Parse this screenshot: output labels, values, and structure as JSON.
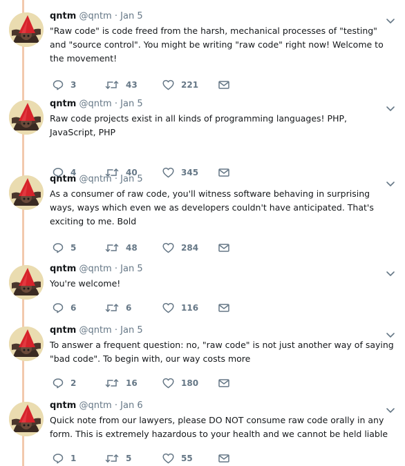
{
  "tweets": [
    {
      "name": "qntm",
      "handle": "@qntm",
      "separator": "·",
      "date": "Jan 5",
      "text": "\"Raw code\" is code freed from the harsh, mechanical processes of \"testing\" and \"source control\". You might be writing \"raw code\" right now! Welcome to the movement!",
      "replies": "3",
      "retweets": "43",
      "likes": "221"
    },
    {
      "name": "qntm",
      "handle": "@qntm",
      "separator": "·",
      "date": "Jan 5",
      "text": "Raw code projects exist in all kinds of programming languages! PHP, JavaScript, PHP",
      "replies": "4",
      "retweets": "40",
      "likes": "345"
    },
    {
      "name": "qntm",
      "handle": "@qntm",
      "separator": "·",
      "date": "Jan 5",
      "text": "As a consumer of raw code, you'll witness software behaving in surprising ways, ways which even we as developers couldn't have anticipated. That's exciting to me. Bold",
      "replies": "5",
      "retweets": "48",
      "likes": "284"
    },
    {
      "name": "qntm",
      "handle": "@qntm",
      "separator": "·",
      "date": "Jan 5",
      "text": "You're welcome!",
      "replies": "6",
      "retweets": "6",
      "likes": "116"
    },
    {
      "name": "qntm",
      "handle": "@qntm",
      "separator": "·",
      "date": "Jan 5",
      "text": "To answer a frequent question: no, \"raw code\" is not just another way of saying \"bad code\". To begin with, our way costs more",
      "replies": "2",
      "retweets": "16",
      "likes": "180"
    },
    {
      "name": "qntm",
      "handle": "@qntm",
      "separator": "·",
      "date": "Jan 6",
      "text": "Quick note from our lawyers, please DO NOT consume raw code orally in any form. This is extremely hazardous to your health and we cannot be held liable",
      "replies": "1",
      "retweets": "5",
      "likes": "55"
    }
  ],
  "icons": {
    "reply": "reply-icon",
    "retweet": "retweet-icon",
    "like": "heart-icon",
    "message": "envelope-icon",
    "more": "chevron-down-icon",
    "avatar": "gnome-avatar"
  },
  "colors": {
    "thread": "#f2c9ad",
    "icon": "#657786",
    "avatar_hat": "#d6232b",
    "avatar_bg": "#eadcb0"
  }
}
